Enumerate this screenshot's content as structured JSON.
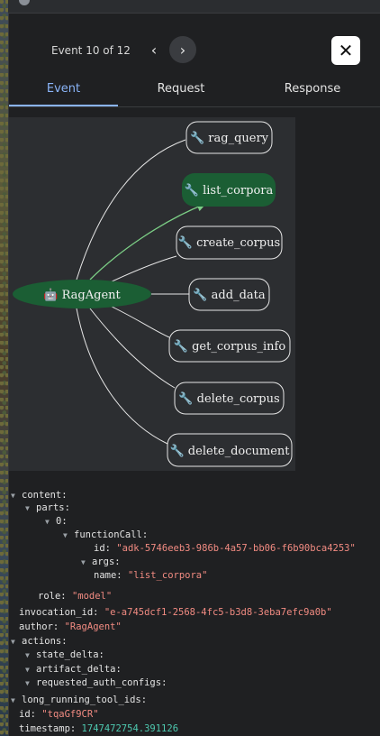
{
  "header": {
    "event_counter": "Event 10 of 12",
    "prev_glyph": "‹",
    "next_glyph": "›",
    "close_glyph": "✕"
  },
  "tabs": [
    {
      "label": "Event",
      "active": true
    },
    {
      "label": "Request",
      "active": false
    },
    {
      "label": "Response",
      "active": false
    }
  ],
  "graph": {
    "agent": {
      "icon": "robot-icon",
      "label": "🤖 RagAgent"
    },
    "tools": [
      {
        "label": "🔧 rag_query",
        "highlighted": false
      },
      {
        "label": "🔧 list_corpora",
        "highlighted": true
      },
      {
        "label": "🔧 create_corpus",
        "highlighted": false
      },
      {
        "label": "🔧 add_data",
        "highlighted": false
      },
      {
        "label": "🔧 get_corpus_info",
        "highlighted": false
      },
      {
        "label": "🔧 delete_corpus",
        "highlighted": false
      },
      {
        "label": "🔧 delete_document",
        "highlighted": false
      }
    ],
    "colors": {
      "agent_fill": "#1b5e34",
      "highlight_fill": "#1b5e34",
      "highlight_edge": "#7ccf86",
      "edge": "#e6e6e6",
      "node_stroke": "#e6e6e6"
    }
  },
  "event_json": {
    "k_content": "content:",
    "k_parts": "parts:",
    "k_0": "0:",
    "k_functionCall": "functionCall:",
    "k_id": "id:",
    "v_fc_id": "\"adk-5746eeb3-986b-4a57-bb06-f6b90bca4253\"",
    "k_args": "args:",
    "k_name": "name:",
    "v_name": "\"list_corpora\"",
    "k_role": "role:",
    "v_role": "\"model\"",
    "k_invocation_id": "invocation_id:",
    "v_invocation_id": "\"e-a745dcf1-2568-4fc5-b3d8-3eba7efc9a0b\"",
    "k_author": "author:",
    "v_author": "\"RagAgent\"",
    "k_actions": "actions:",
    "k_state_delta": "state_delta:",
    "k_artifact_delta": "artifact_delta:",
    "k_requested_auth_configs": "requested_auth_configs:",
    "k_long_running_tool_ids": "long_running_tool_ids:",
    "k_event_id": "id:",
    "v_event_id": "\"tqaGf9CR\"",
    "k_timestamp": "timestamp:",
    "v_timestamp": "1747472754.391126"
  }
}
